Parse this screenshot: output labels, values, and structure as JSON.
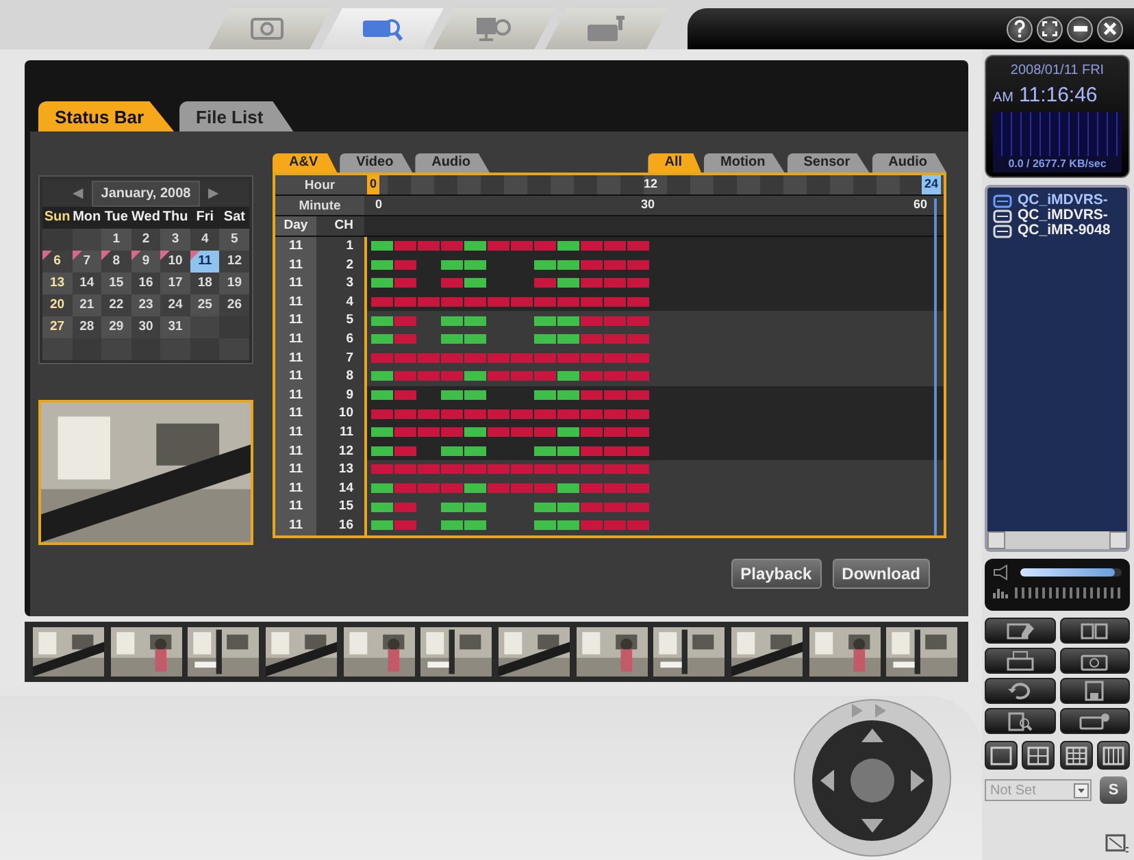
{
  "top_tabs": [
    {
      "kind": "camera",
      "selected": false
    },
    {
      "kind": "search",
      "selected": true
    },
    {
      "kind": "monitor",
      "selected": false
    },
    {
      "kind": "settings",
      "selected": false
    }
  ],
  "window_buttons": [
    {
      "kind": "help"
    },
    {
      "kind": "fullscreen"
    },
    {
      "kind": "minimize"
    },
    {
      "kind": "close"
    }
  ],
  "panel_tabs": [
    {
      "label": "Status Bar",
      "selected": true
    },
    {
      "label": "File List",
      "selected": false
    }
  ],
  "calendar": {
    "prev": "◀",
    "title": "January, 2008",
    "next": "▶",
    "weekdays": [
      "Sun",
      "Mon",
      "Tue",
      "Wed",
      "Thu",
      "Fri",
      "Sat"
    ],
    "weeks": [
      [
        {
          "kind": "blank"
        },
        {
          "kind": "blank"
        },
        {
          "kind": "day",
          "day": "1",
          "recorded": false,
          "selected": false
        },
        {
          "kind": "day",
          "day": "2",
          "recorded": false,
          "selected": false
        },
        {
          "kind": "day",
          "day": "3",
          "recorded": false,
          "selected": false
        },
        {
          "kind": "day",
          "day": "4",
          "recorded": false,
          "selected": false
        },
        {
          "kind": "day",
          "day": "5",
          "recorded": false,
          "selected": false
        }
      ],
      [
        {
          "kind": "day",
          "day": "6",
          "recorded": true,
          "selected": false
        },
        {
          "kind": "day",
          "day": "7",
          "recorded": true,
          "selected": false
        },
        {
          "kind": "day",
          "day": "8",
          "recorded": true,
          "selected": false
        },
        {
          "kind": "day",
          "day": "9",
          "recorded": true,
          "selected": false
        },
        {
          "kind": "day",
          "day": "10",
          "recorded": true,
          "selected": false
        },
        {
          "kind": "day",
          "day": "11",
          "recorded": true,
          "selected": true
        },
        {
          "kind": "day",
          "day": "12",
          "recorded": false,
          "selected": false
        }
      ],
      [
        {
          "kind": "day",
          "day": "13",
          "recorded": false,
          "selected": false
        },
        {
          "kind": "day",
          "day": "14",
          "recorded": false,
          "selected": false
        },
        {
          "kind": "day",
          "day": "15",
          "recorded": false,
          "selected": false
        },
        {
          "kind": "day",
          "day": "16",
          "recorded": false,
          "selected": false
        },
        {
          "kind": "day",
          "day": "17",
          "recorded": false,
          "selected": false
        },
        {
          "kind": "day",
          "day": "18",
          "recorded": false,
          "selected": false
        },
        {
          "kind": "day",
          "day": "19",
          "recorded": false,
          "selected": false
        }
      ],
      [
        {
          "kind": "day",
          "day": "20",
          "recorded": false,
          "selected": false
        },
        {
          "kind": "day",
          "day": "21",
          "recorded": false,
          "selected": false
        },
        {
          "kind": "day",
          "day": "22",
          "recorded": false,
          "selected": false
        },
        {
          "kind": "day",
          "day": "23",
          "recorded": false,
          "selected": false
        },
        {
          "kind": "day",
          "day": "24",
          "recorded": false,
          "selected": false
        },
        {
          "kind": "day",
          "day": "25",
          "recorded": false,
          "selected": false
        },
        {
          "kind": "day",
          "day": "26",
          "recorded": false,
          "selected": false
        }
      ],
      [
        {
          "kind": "day",
          "day": "27",
          "recorded": false,
          "selected": false
        },
        {
          "kind": "day",
          "day": "28",
          "recorded": false,
          "selected": false
        },
        {
          "kind": "day",
          "day": "29",
          "recorded": false,
          "selected": false
        },
        {
          "kind": "day",
          "day": "30",
          "recorded": false,
          "selected": false
        },
        {
          "kind": "day",
          "day": "31",
          "recorded": false,
          "selected": false
        },
        {
          "kind": "blank"
        },
        {
          "kind": "blank"
        }
      ],
      [
        {
          "kind": "blank"
        },
        {
          "kind": "blank"
        },
        {
          "kind": "blank"
        },
        {
          "kind": "blank"
        },
        {
          "kind": "blank"
        },
        {
          "kind": "blank"
        },
        {
          "kind": "blank"
        }
      ]
    ]
  },
  "timeline": {
    "type_tabs": [
      {
        "label": "A&V",
        "selected": true
      },
      {
        "label": "Video",
        "selected": false
      },
      {
        "label": "Audio",
        "selected": false
      }
    ],
    "event_tabs": [
      {
        "label": "All",
        "selected": true
      },
      {
        "label": "Motion",
        "selected": false
      },
      {
        "label": "Sensor",
        "selected": false
      },
      {
        "label": "Audio",
        "selected": false
      }
    ],
    "hour_label": "Hour",
    "hour_marks": [
      "0",
      "12",
      "24"
    ],
    "minute_label": "Minute",
    "minute_marks": [
      "0",
      "30",
      "60"
    ],
    "day_label": "Day",
    "channel_label": "CH",
    "rows": [
      {
        "day": "11",
        "ch": "1",
        "segments": [
          {
            "kind": "motion"
          },
          {
            "kind": "record"
          },
          {
            "kind": "record"
          },
          {
            "kind": "record"
          },
          {
            "kind": "motion"
          },
          {
            "kind": "record"
          },
          {
            "kind": "record"
          },
          {
            "kind": "record"
          },
          {
            "kind": "motion"
          },
          {
            "kind": "record"
          },
          {
            "kind": "record"
          },
          {
            "kind": "record"
          }
        ]
      },
      {
        "day": "11",
        "ch": "2",
        "segments": [
          {
            "kind": "motion"
          },
          {
            "kind": "record"
          },
          {
            "kind": "gap"
          },
          {
            "kind": "motion"
          },
          {
            "kind": "motion"
          },
          {
            "kind": "gap"
          },
          {
            "kind": "gap"
          },
          {
            "kind": "motion"
          },
          {
            "kind": "motion"
          },
          {
            "kind": "record"
          },
          {
            "kind": "record"
          },
          {
            "kind": "record"
          }
        ]
      },
      {
        "day": "11",
        "ch": "3",
        "segments": [
          {
            "kind": "motion"
          },
          {
            "kind": "record"
          },
          {
            "kind": "gap"
          },
          {
            "kind": "record"
          },
          {
            "kind": "motion"
          },
          {
            "kind": "gap"
          },
          {
            "kind": "gap"
          },
          {
            "kind": "record"
          },
          {
            "kind": "motion"
          },
          {
            "kind": "record"
          },
          {
            "kind": "record"
          },
          {
            "kind": "record"
          }
        ]
      },
      {
        "day": "11",
        "ch": "4",
        "segments": [
          {
            "kind": "record"
          },
          {
            "kind": "record"
          },
          {
            "kind": "record"
          },
          {
            "kind": "record"
          },
          {
            "kind": "record"
          },
          {
            "kind": "record"
          },
          {
            "kind": "record"
          },
          {
            "kind": "record"
          },
          {
            "kind": "record"
          },
          {
            "kind": "record"
          },
          {
            "kind": "record"
          },
          {
            "kind": "record"
          }
        ]
      },
      {
        "day": "11",
        "ch": "5",
        "segments": [
          {
            "kind": "motion"
          },
          {
            "kind": "record"
          },
          {
            "kind": "gap"
          },
          {
            "kind": "motion"
          },
          {
            "kind": "motion"
          },
          {
            "kind": "gap"
          },
          {
            "kind": "gap"
          },
          {
            "kind": "motion"
          },
          {
            "kind": "motion"
          },
          {
            "kind": "record"
          },
          {
            "kind": "record"
          },
          {
            "kind": "record"
          }
        ]
      },
      {
        "day": "11",
        "ch": "6",
        "segments": [
          {
            "kind": "motion"
          },
          {
            "kind": "record"
          },
          {
            "kind": "gap"
          },
          {
            "kind": "motion"
          },
          {
            "kind": "motion"
          },
          {
            "kind": "gap"
          },
          {
            "kind": "gap"
          },
          {
            "kind": "motion"
          },
          {
            "kind": "motion"
          },
          {
            "kind": "record"
          },
          {
            "kind": "record"
          },
          {
            "kind": "record"
          }
        ]
      },
      {
        "day": "11",
        "ch": "7",
        "segments": [
          {
            "kind": "record"
          },
          {
            "kind": "record"
          },
          {
            "kind": "record"
          },
          {
            "kind": "record"
          },
          {
            "kind": "record"
          },
          {
            "kind": "record"
          },
          {
            "kind": "record"
          },
          {
            "kind": "record"
          },
          {
            "kind": "record"
          },
          {
            "kind": "record"
          },
          {
            "kind": "record"
          },
          {
            "kind": "record"
          }
        ]
      },
      {
        "day": "11",
        "ch": "8",
        "segments": [
          {
            "kind": "motion"
          },
          {
            "kind": "record"
          },
          {
            "kind": "record"
          },
          {
            "kind": "record"
          },
          {
            "kind": "motion"
          },
          {
            "kind": "record"
          },
          {
            "kind": "record"
          },
          {
            "kind": "record"
          },
          {
            "kind": "motion"
          },
          {
            "kind": "record"
          },
          {
            "kind": "record"
          },
          {
            "kind": "record"
          }
        ]
      },
      {
        "day": "11",
        "ch": "9",
        "segments": [
          {
            "kind": "motion"
          },
          {
            "kind": "record"
          },
          {
            "kind": "gap"
          },
          {
            "kind": "motion"
          },
          {
            "kind": "motion"
          },
          {
            "kind": "gap"
          },
          {
            "kind": "gap"
          },
          {
            "kind": "motion"
          },
          {
            "kind": "motion"
          },
          {
            "kind": "record"
          },
          {
            "kind": "record"
          },
          {
            "kind": "record"
          }
        ]
      },
      {
        "day": "11",
        "ch": "10",
        "segments": [
          {
            "kind": "record"
          },
          {
            "kind": "record"
          },
          {
            "kind": "record"
          },
          {
            "kind": "record"
          },
          {
            "kind": "record"
          },
          {
            "kind": "record"
          },
          {
            "kind": "record"
          },
          {
            "kind": "record"
          },
          {
            "kind": "record"
          },
          {
            "kind": "record"
          },
          {
            "kind": "record"
          },
          {
            "kind": "record"
          }
        ]
      },
      {
        "day": "11",
        "ch": "11",
        "segments": [
          {
            "kind": "motion"
          },
          {
            "kind": "record"
          },
          {
            "kind": "record"
          },
          {
            "kind": "record"
          },
          {
            "kind": "motion"
          },
          {
            "kind": "record"
          },
          {
            "kind": "record"
          },
          {
            "kind": "record"
          },
          {
            "kind": "motion"
          },
          {
            "kind": "record"
          },
          {
            "kind": "record"
          },
          {
            "kind": "record"
          }
        ]
      },
      {
        "day": "11",
        "ch": "12",
        "segments": [
          {
            "kind": "motion"
          },
          {
            "kind": "record"
          },
          {
            "kind": "gap"
          },
          {
            "kind": "motion"
          },
          {
            "kind": "motion"
          },
          {
            "kind": "gap"
          },
          {
            "kind": "gap"
          },
          {
            "kind": "motion"
          },
          {
            "kind": "motion"
          },
          {
            "kind": "record"
          },
          {
            "kind": "record"
          },
          {
            "kind": "record"
          }
        ]
      },
      {
        "day": "11",
        "ch": "13",
        "segments": [
          {
            "kind": "record"
          },
          {
            "kind": "record"
          },
          {
            "kind": "record"
          },
          {
            "kind": "record"
          },
          {
            "kind": "record"
          },
          {
            "kind": "record"
          },
          {
            "kind": "record"
          },
          {
            "kind": "record"
          },
          {
            "kind": "record"
          },
          {
            "kind": "record"
          },
          {
            "kind": "record"
          },
          {
            "kind": "record"
          }
        ]
      },
      {
        "day": "11",
        "ch": "14",
        "segments": [
          {
            "kind": "motion"
          },
          {
            "kind": "record"
          },
          {
            "kind": "record"
          },
          {
            "kind": "record"
          },
          {
            "kind": "motion"
          },
          {
            "kind": "record"
          },
          {
            "kind": "record"
          },
          {
            "kind": "record"
          },
          {
            "kind": "motion"
          },
          {
            "kind": "record"
          },
          {
            "kind": "record"
          },
          {
            "kind": "record"
          }
        ]
      },
      {
        "day": "11",
        "ch": "15",
        "segments": [
          {
            "kind": "motion"
          },
          {
            "kind": "record"
          },
          {
            "kind": "gap"
          },
          {
            "kind": "motion"
          },
          {
            "kind": "motion"
          },
          {
            "kind": "gap"
          },
          {
            "kind": "gap"
          },
          {
            "kind": "motion"
          },
          {
            "kind": "motion"
          },
          {
            "kind": "record"
          },
          {
            "kind": "record"
          },
          {
            "kind": "record"
          }
        ]
      },
      {
        "day": "11",
        "ch": "16",
        "segments": [
          {
            "kind": "motion"
          },
          {
            "kind": "record"
          },
          {
            "kind": "gap"
          },
          {
            "kind": "motion"
          },
          {
            "kind": "motion"
          },
          {
            "kind": "gap"
          },
          {
            "kind": "gap"
          },
          {
            "kind": "motion"
          },
          {
            "kind": "motion"
          },
          {
            "kind": "record"
          },
          {
            "kind": "record"
          },
          {
            "kind": "record"
          }
        ]
      }
    ]
  },
  "actions": [
    {
      "label": "Playback"
    },
    {
      "label": "Download"
    }
  ],
  "clock": {
    "date": "2008/01/11 FRI",
    "meridiem": "AM",
    "time": "11:16:46",
    "rate": "0.0 / 2677.7 KB/sec"
  },
  "devices": [
    {
      "name": "QC_iMDVRS-",
      "selected": true
    },
    {
      "name": "QC_iMDVRS-",
      "selected": false
    },
    {
      "name": "QC_iMR-9048",
      "selected": false
    }
  ],
  "volume": {
    "level": 0.93
  },
  "tool_buttons": [
    {
      "kind": "edit"
    },
    {
      "kind": "book"
    },
    {
      "kind": "print"
    },
    {
      "kind": "camera"
    },
    {
      "kind": "refresh"
    },
    {
      "kind": "save"
    },
    {
      "kind": "search"
    },
    {
      "kind": "message"
    }
  ],
  "layouts": [
    {
      "kind": "single"
    },
    {
      "kind": "quad"
    },
    {
      "kind": "nine"
    },
    {
      "kind": "columns"
    }
  ],
  "preset": {
    "value": "Not Set",
    "button": "S"
  }
}
